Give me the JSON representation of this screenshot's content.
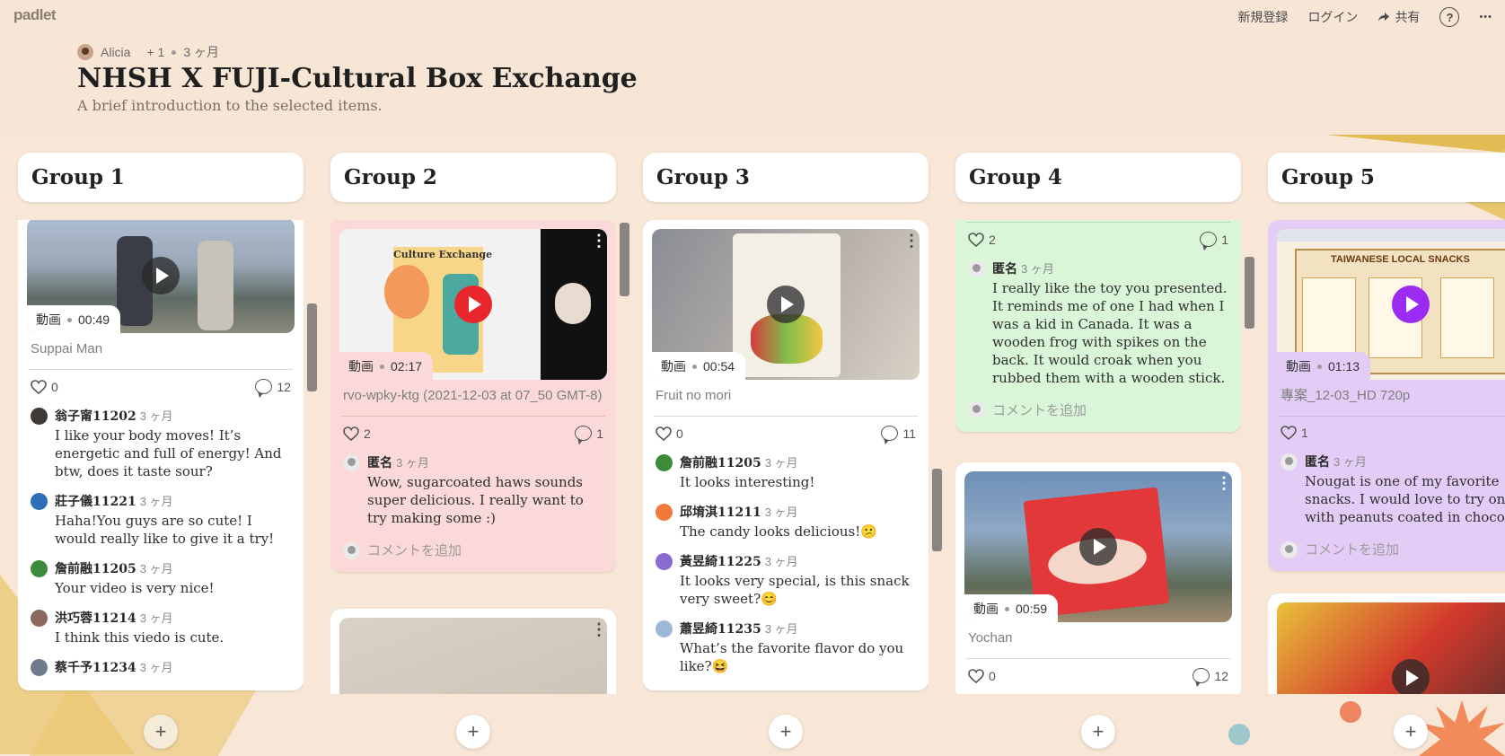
{
  "app": {
    "logo": "padlet"
  },
  "topnav": {
    "signup": "新規登録",
    "login": "ログイン",
    "share": "共有",
    "help": "?",
    "more": "•••"
  },
  "board": {
    "author": "Alicia",
    "plus": "+ 1",
    "age": "3 ヶ月",
    "title": "NHSH X FUJI-Cultural Box Exchange",
    "subtitle": "A brief introduction to the selected items."
  },
  "columns": [
    {
      "title": "Group 1"
    },
    {
      "title": "Group 2"
    },
    {
      "title": "Group 3"
    },
    {
      "title": "Group 4"
    },
    {
      "title": "Group 5"
    }
  ],
  "add_label": "+",
  "video_label": "動画",
  "add_comment": "コメントを追加",
  "cards": {
    "g1": {
      "duration": "00:49",
      "title": "Suppai Man",
      "likes": "0",
      "comments": "12",
      "comment_list": [
        {
          "name": "翁子甯11202",
          "time": "3 ヶ月",
          "text": "I like your body moves! It’s energetic and full of energy! And btw, does it taste sour?"
        },
        {
          "name": "莊子儀11221",
          "time": "3 ヶ月",
          "text": "Haha!You guys are so cute! I would really like to give it a try!"
        },
        {
          "name": "詹前融11205",
          "time": "3 ヶ月",
          "text": "Your video is very nice!"
        },
        {
          "name": "洪巧蓉11214",
          "time": "3 ヶ月",
          "text": "I think this viedo is cute."
        },
        {
          "name": "蔡千予11234",
          "time": "3 ヶ月",
          "text": ""
        }
      ]
    },
    "g2": {
      "duration": "02:17",
      "slide_title": "Culture Exchange",
      "title": "rvo-wpky-ktg (2021-12-03 at 07_50 GMT-8)",
      "likes": "2",
      "comments": "1",
      "comment_list": [
        {
          "name": "匿名",
          "time": "3 ヶ月",
          "text": "Wow, sugarcoated haws sounds super delicious. I really want to try making some :)"
        }
      ]
    },
    "g3": {
      "duration": "00:54",
      "title": "Fruit no mori",
      "likes": "0",
      "comments": "11",
      "comment_list": [
        {
          "name": "詹前融11205",
          "time": "3 ヶ月",
          "text": "It looks interesting!"
        },
        {
          "name": "邱堉淇11211",
          "time": "3 ヶ月",
          "text": "The candy looks delicious!😕"
        },
        {
          "name": "黃昱綺11225",
          "time": "3 ヶ月",
          "text": "It looks very special, is this snack very sweet?😊"
        },
        {
          "name": "蕭昱綺11235",
          "time": "3 ヶ月",
          "text": "What’s the favorite flavor do you like?😆"
        }
      ]
    },
    "g4a": {
      "likes": "2",
      "comments": "1",
      "comment_list": [
        {
          "name": "匿名",
          "time": "3 ヶ月",
          "text": "I really like the toy you presented. It reminds me of one I had when I was a kid in Canada. It was a wooden frog with spikes on the back. It would croak when you rubbed them with a wooden stick."
        }
      ]
    },
    "g4b": {
      "duration": "00:59",
      "title": "Yochan",
      "likes": "0",
      "comments": "12"
    },
    "g5": {
      "duration": "01:13",
      "slide_title": "TAIWANESE LOCAL SNACKS",
      "title": "專案_12-03_HD 720p",
      "likes": "1",
      "comment_list": [
        {
          "name": "匿名",
          "time": "3 ヶ月",
          "text": "Nougat is one of my favorite snacks. I would love to try one with peanuts coated in chocolate."
        }
      ]
    }
  },
  "colors": {
    "pink": "#fbd9d8",
    "green": "#daf6d8",
    "purple": "#e3cdf7",
    "background": "#f8e6d6"
  }
}
